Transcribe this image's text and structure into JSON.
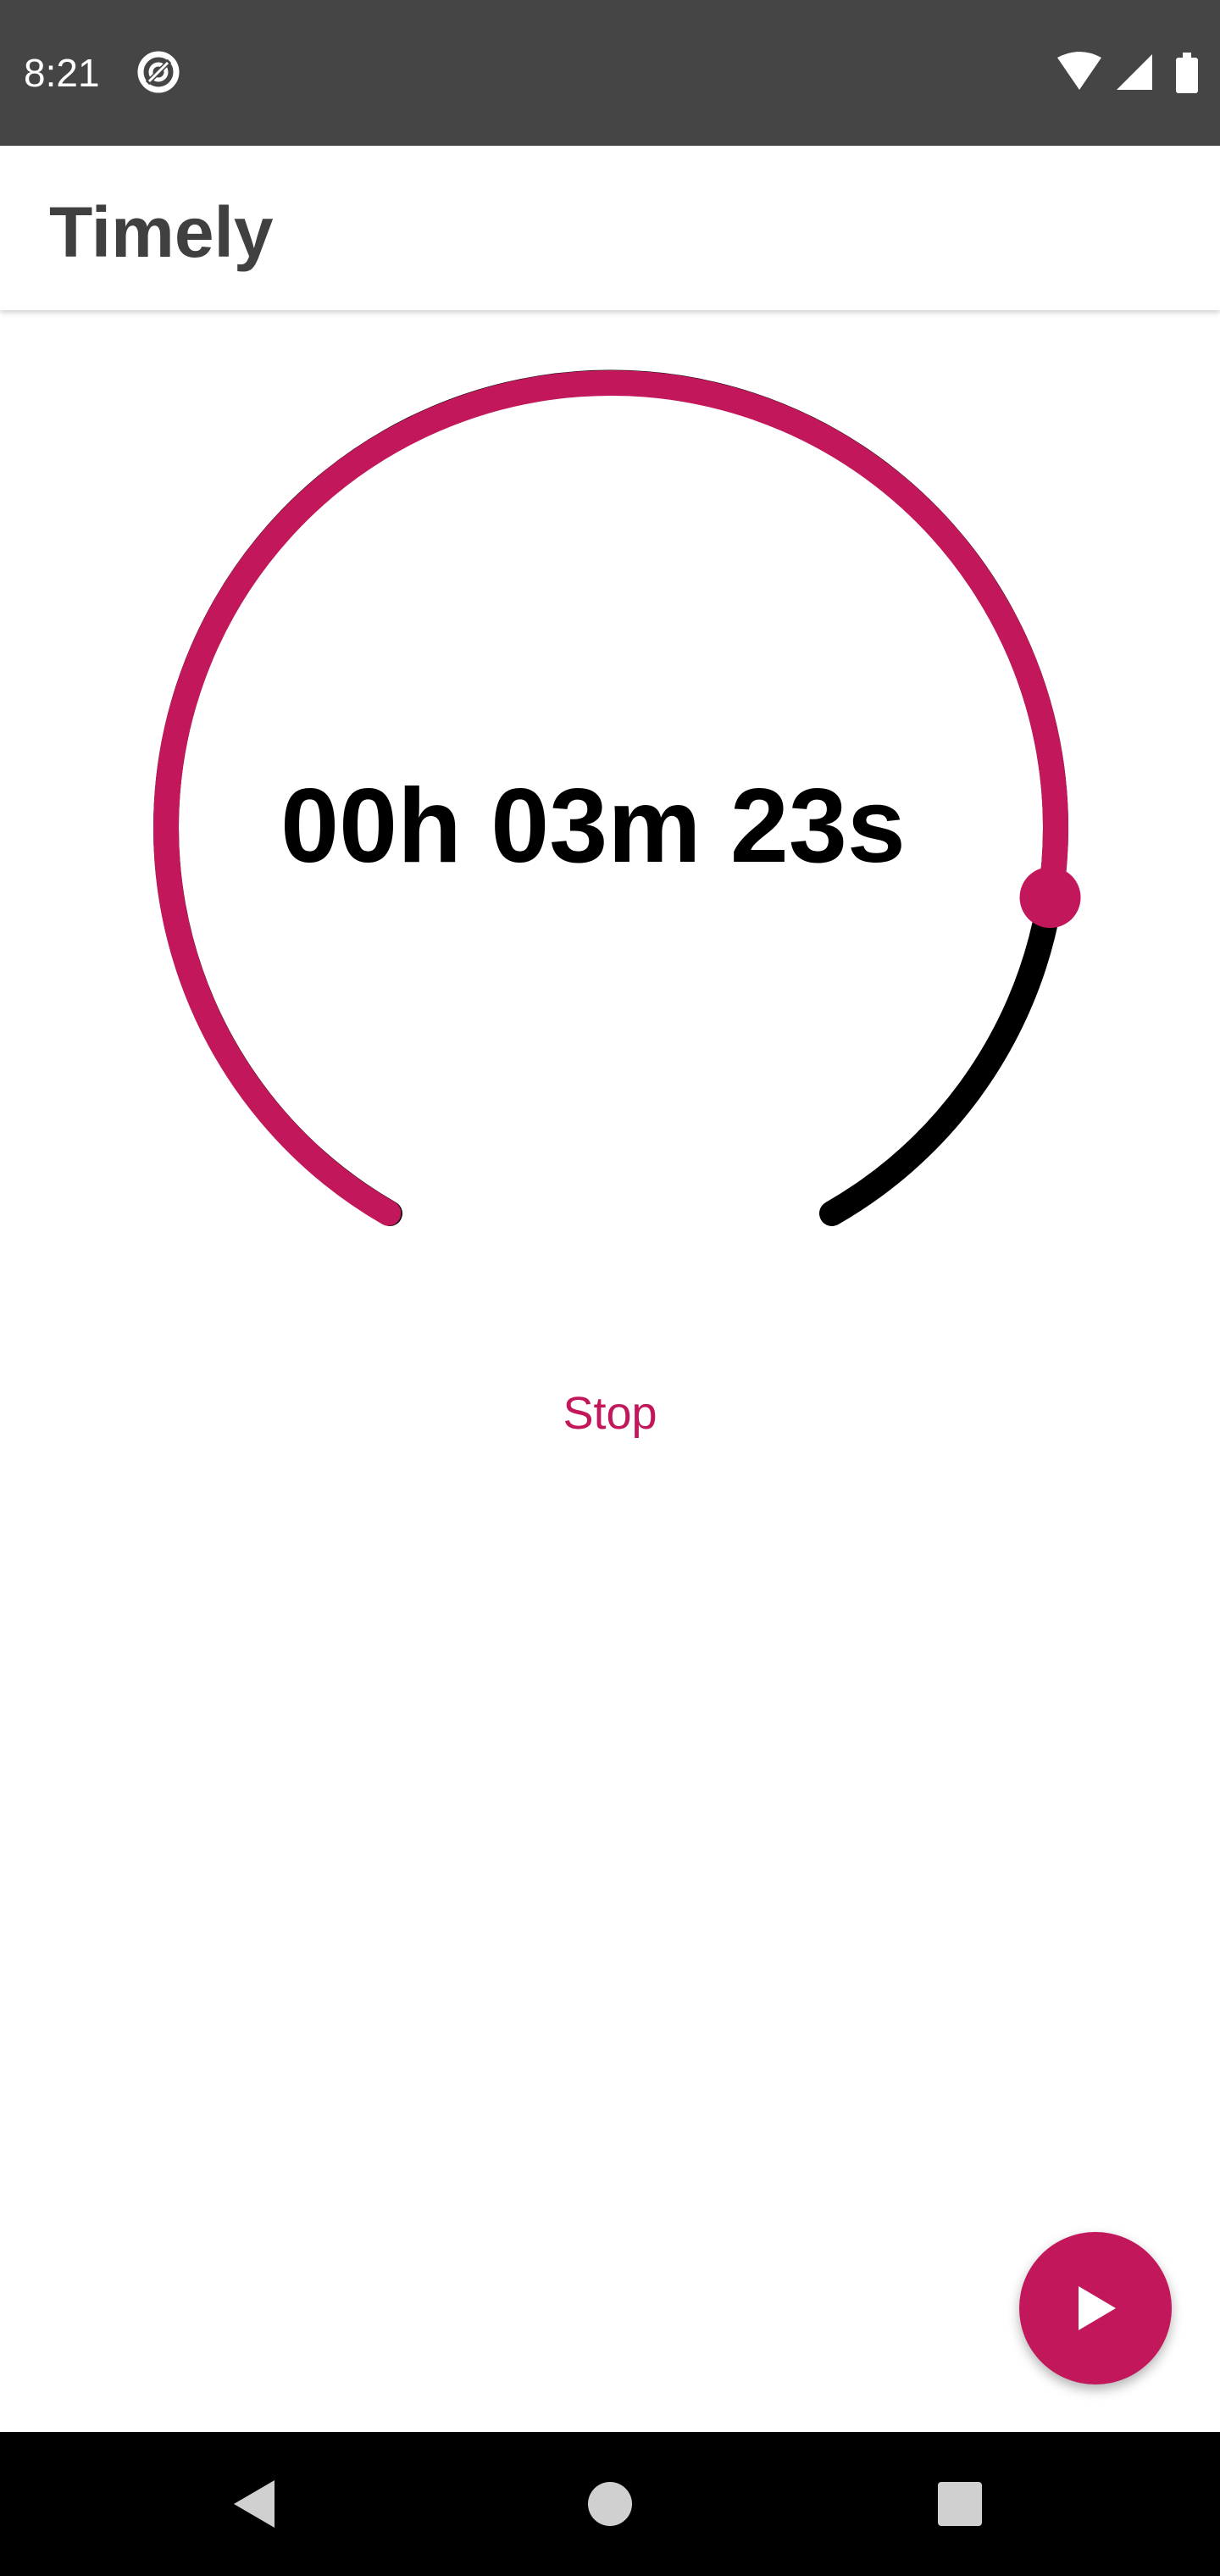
{
  "status_bar": {
    "time": "8:21",
    "left_icons": [
      "do-not-disturb-ring-icon"
    ],
    "right_icons": [
      "wifi-icon",
      "cell-signal-icon",
      "battery-icon"
    ],
    "background": "#454545"
  },
  "app_bar": {
    "title": "Timely"
  },
  "timer": {
    "display": "00h 03m 23s",
    "accent_color": "#c2185b",
    "track_color": "#000000",
    "progress_fraction": 0.83
  },
  "controls": {
    "stop_label": "Stop",
    "fab_icon": "play-icon"
  },
  "nav_bar": {
    "buttons": [
      "back-icon",
      "home-icon",
      "recents-icon"
    ]
  }
}
